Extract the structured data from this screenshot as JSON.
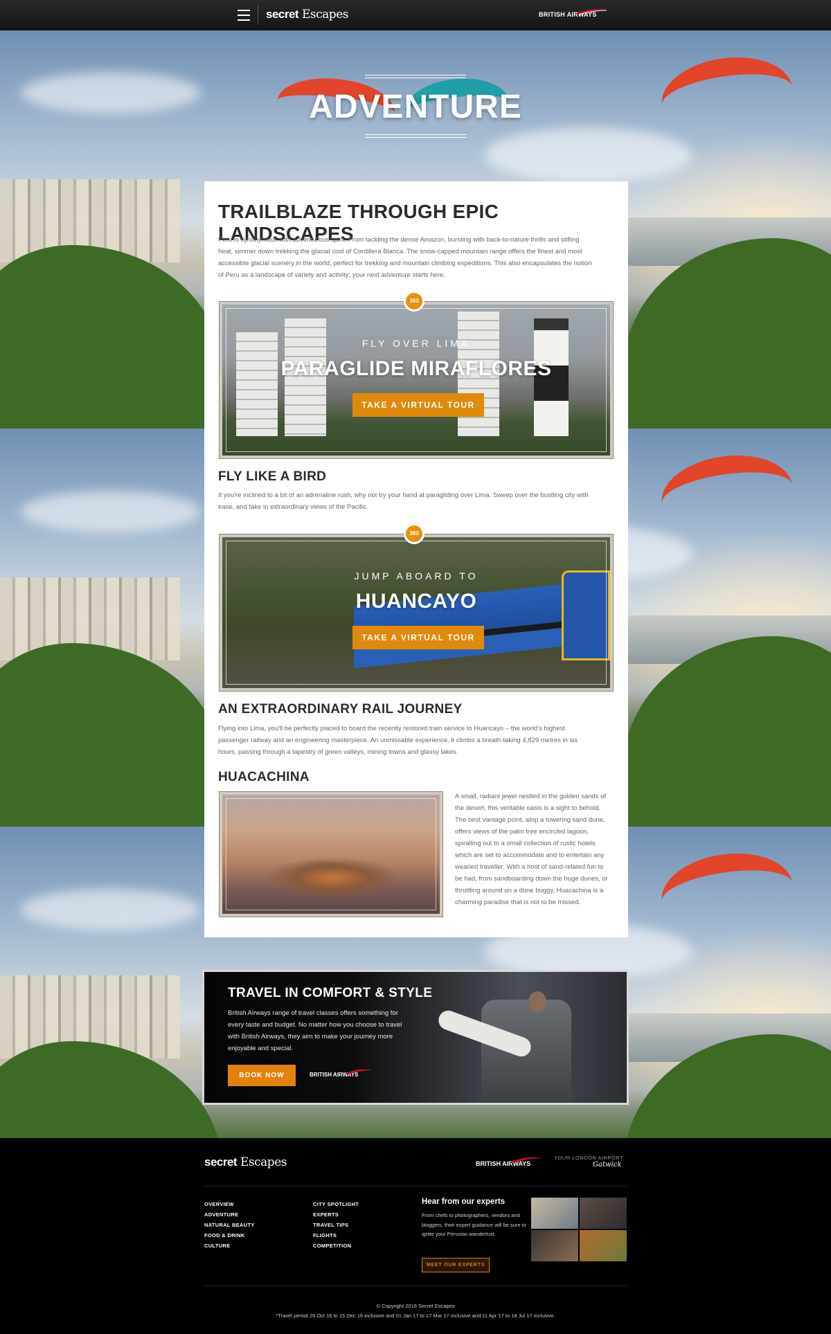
{
  "topbar": {
    "logo_bold": "secret",
    "logo_script": "Escapes",
    "partner": "BRITISH AIRWAYS"
  },
  "hero": {
    "title": "ADVENTURE"
  },
  "intro": {
    "heading": "TRAILBLAZE THROUGH EPIC LANDSCAPES",
    "body": "Peru is synonymous with adventurous spirit. From tackling the dense Amazon, bursting with back-to-nature thrills and stifling heat, simmer down trekking the glacial cool of Cordillera Blanca. The snow-capped mountain range offers the finest and most accessible glacial scenery in the world, perfect for trekking and mountain climbing expeditions. This also encapsulates the notion of Peru as a landscape of variety and activity; your next adventure starts here."
  },
  "tours": [
    {
      "badge": "360",
      "eyebrow": "FLY OVER LIMA",
      "title": "PARAGLIDE MIRAFLORES",
      "button": "TAKE A VIRTUAL TOUR"
    },
    {
      "badge": "360",
      "eyebrow": "JUMP ABOARD TO",
      "title": "HUANCAYO",
      "button": "TAKE A VIRTUAL TOUR"
    }
  ],
  "sections": [
    {
      "heading": "FLY LIKE A BIRD",
      "body": "If you're inclined to a bit of an adrenaline rush, why not try your hand at paragliding over Lima. Sweep over the bustling city with ease, and take in extraordinary views of the Pacific."
    },
    {
      "heading": "AN EXTRAORDINARY RAIL JOURNEY",
      "body": "Flying into Lima, you'll be perfectly placed to board the recently restored train service to Huancayo – the world's highest passenger railway and an engineering masterpiece. An unmissable experience, it climbs a breath-taking 4,829 metres in six hours, passing through a tapestry of green valleys, mining towns and glassy lakes."
    },
    {
      "heading": "HUACACHINA",
      "body": "A small, radiant jewel nestled in the golden sands of the desert, this veritable oasis is a sight to behold. The best vantage point, atop a towering sand dune, offers views of the palm tree encircled lagoon, spiralling out to a small collection of rustic hotels which are set to accommodate and to entertain any wearied traveller. With a host of sand-related fun to be had, from sandboarding down the huge dunes, or throttling around on a dune buggy, Huacachina is a charming paradise that is not to be missed."
    }
  ],
  "comfort": {
    "title": "TRAVEL IN COMFORT & STYLE",
    "body": "British Airways range of travel classes offers something for every taste and budget. No matter how you choose to travel with British Airways, they aim to make your journey more enjoyable and special.",
    "button": "BOOK NOW",
    "partner": "BRITISH AIRWAYS"
  },
  "footer": {
    "logo_bold": "secret",
    "logo_script": "Escapes",
    "partner": "BRITISH AIRWAYS",
    "airport_top": "YOUR LONDON AIRPORT",
    "airport_name": "Gatwick",
    "nav_left": [
      "OVERVIEW",
      "ADVENTURE",
      "NATURAL BEAUTY",
      "FOOD & DRINK",
      "CULTURE"
    ],
    "nav_right": [
      "CITY SPOTLIGHT",
      "EXPERTS",
      "TRAVEL TIPS",
      "FLIGHTS",
      "COMPETITION"
    ],
    "experts_heading": "Hear from our experts",
    "experts_body": "From chefs to photographers, vendors and bloggers, their expert guidance will be sure to ignite your Peruvian wanderlust.",
    "experts_button": "MEET OUR EXPERTS",
    "copyright": "© Copyright 2016 Secret Escapes",
    "travel_period": "*Travel period 26 Oct 16 to 15 Dec 16 inclusive and 01 Jan 17 to 17 Mar 17 inclusive and 11 Apr 17 to 18 Jul 17 inclusive."
  },
  "colors": {
    "accent": "#e0820c",
    "heading": "#2b2b2b",
    "body": "#666666"
  }
}
